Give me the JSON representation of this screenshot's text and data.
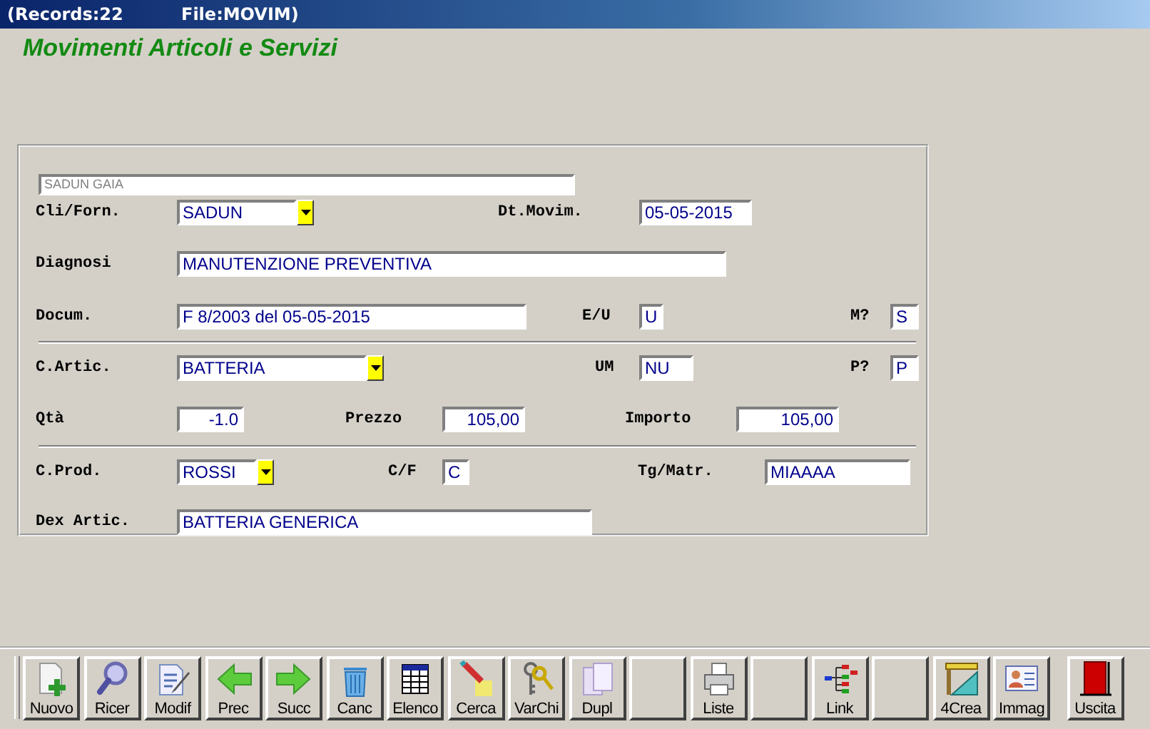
{
  "title_bar": {
    "records": "(Records:22",
    "file": "File:MOVIM)"
  },
  "heading": "Movimenti Articoli e Servizi",
  "customer_name": "SADUN GAIA",
  "form_rows": [
    {
      "separator": false,
      "fields": [
        {
          "label": "Cli/Forn.",
          "value": "SADUN",
          "kind": "combo"
        },
        {
          "label": "Dt.Movim.",
          "value": "05-05-2015",
          "kind": "text"
        }
      ]
    },
    {
      "separator": false,
      "fields": [
        {
          "label": "Diagnosi",
          "value": "MANUTENZIONE PREVENTIVA",
          "kind": "text"
        }
      ]
    },
    {
      "separator": false,
      "fields": [
        {
          "label": "Docum.",
          "value": "F 8/2003 del 05-05-2015",
          "kind": "text"
        },
        {
          "label": "E/U",
          "value": "U",
          "kind": "text"
        },
        {
          "label": "M?",
          "value": "S",
          "kind": "text"
        }
      ]
    },
    {
      "separator": true,
      "fields": [
        {
          "label": "C.Artic.",
          "value": "BATTERIA",
          "kind": "combo"
        },
        {
          "label": "UM",
          "value": "NU",
          "kind": "text"
        },
        {
          "label": "P?",
          "value": "P",
          "kind": "text"
        }
      ]
    },
    {
      "separator": false,
      "fields": [
        {
          "label": "Qtà",
          "value": "-1.0",
          "kind": "number"
        },
        {
          "label": "Prezzo",
          "value": "105,00",
          "kind": "number"
        },
        {
          "label": "Importo",
          "value": "105,00",
          "kind": "number"
        }
      ]
    },
    {
      "separator": true,
      "fields": [
        {
          "label": "C.Prod.",
          "value": "ROSSI",
          "kind": "combo"
        },
        {
          "label": "C/F",
          "value": "C",
          "kind": "text"
        },
        {
          "label": "Tg/Matr.",
          "value": "MIAAAA",
          "kind": "text"
        }
      ]
    },
    {
      "separator": false,
      "fields": [
        {
          "label": "Dex Artic.",
          "value": "BATTERIA GENERICA",
          "kind": "text"
        }
      ]
    }
  ],
  "toolbar": [
    {
      "kind": "button",
      "label": "Nuovo"
    },
    {
      "kind": "button",
      "label": "Ricer"
    },
    {
      "kind": "button",
      "label": "Modif"
    },
    {
      "kind": "button",
      "label": "Prec"
    },
    {
      "kind": "button",
      "label": "Succ"
    },
    {
      "kind": "button",
      "label": "Canc"
    },
    {
      "kind": "button",
      "label": "Elenco"
    },
    {
      "kind": "button",
      "label": "Cerca"
    },
    {
      "kind": "button",
      "label": "VarChi"
    },
    {
      "kind": "button",
      "label": "Dupl"
    },
    {
      "kind": "blank"
    },
    {
      "kind": "button",
      "label": "Liste"
    },
    {
      "kind": "blank"
    },
    {
      "kind": "button",
      "label": "Link"
    },
    {
      "kind": "blank"
    },
    {
      "kind": "button",
      "label": "4Crea"
    },
    {
      "kind": "button",
      "label": "Immag"
    },
    {
      "kind": "button",
      "label": "Uscita"
    }
  ]
}
